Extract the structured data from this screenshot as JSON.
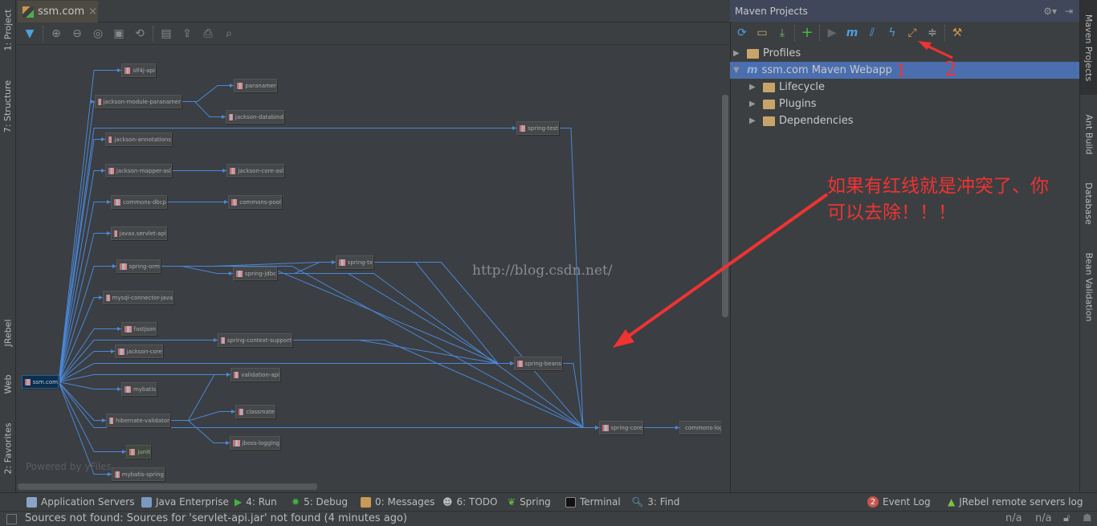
{
  "left_strip": {
    "project": "1: Project",
    "structure": "7: Structure",
    "jrebel": "JRebel",
    "web": "Web",
    "favorites": "2: Favorites"
  },
  "editor": {
    "tab_label": "ssm.com",
    "tab_close": "×",
    "watermark": "Powered by yFiles",
    "blog_watermark": "http://blog.csdn.net/"
  },
  "graph": {
    "nodes": [
      "ssm.com",
      "slf4j-api",
      "jackson-module-paranamer",
      "paranamer",
      "jackson-databind",
      "spring-test",
      "jackson-annotations",
      "jackson-mapper-asl",
      "jackson-core-asl",
      "commons-dbcp",
      "commons-pool",
      "javax.servlet-api",
      "spring-orm",
      "spring-jdbc",
      "spring-tx",
      "mysql-connector-java",
      "fastjson",
      "spring-context-support",
      "jackson-core",
      "spring-beans",
      "validation-api",
      "mybatis",
      "hibernate-validator",
      "classmate",
      "jboss-logging",
      "junit",
      "mybatis-spring",
      "spring-core",
      "commons-logging"
    ],
    "edges": [
      [
        "ssm.com",
        "slf4j-api"
      ],
      [
        "ssm.com",
        "jackson-module-paranamer"
      ],
      [
        "ssm.com",
        "spring-test"
      ],
      [
        "ssm.com",
        "jackson-annotations"
      ],
      [
        "ssm.com",
        "jackson-mapper-asl"
      ],
      [
        "ssm.com",
        "commons-dbcp"
      ],
      [
        "ssm.com",
        "javax.servlet-api"
      ],
      [
        "ssm.com",
        "spring-orm"
      ],
      [
        "ssm.com",
        "mysql-connector-java"
      ],
      [
        "ssm.com",
        "fastjson"
      ],
      [
        "ssm.com",
        "spring-context-support"
      ],
      [
        "ssm.com",
        "jackson-core"
      ],
      [
        "ssm.com",
        "spring-beans"
      ],
      [
        "ssm.com",
        "validation-api"
      ],
      [
        "ssm.com",
        "mybatis"
      ],
      [
        "ssm.com",
        "hibernate-validator"
      ],
      [
        "ssm.com",
        "junit"
      ],
      [
        "ssm.com",
        "mybatis-spring"
      ],
      [
        "ssm.com",
        "spring-core"
      ],
      [
        "jackson-module-paranamer",
        "paranamer"
      ],
      [
        "jackson-module-paranamer",
        "jackson-databind"
      ],
      [
        "jackson-mapper-asl",
        "jackson-core-asl"
      ],
      [
        "commons-dbcp",
        "commons-pool"
      ],
      [
        "spring-orm",
        "spring-jdbc"
      ],
      [
        "spring-orm",
        "spring-tx"
      ],
      [
        "spring-orm",
        "spring-beans"
      ],
      [
        "spring-orm",
        "spring-core"
      ],
      [
        "spring-jdbc",
        "spring-tx"
      ],
      [
        "spring-jdbc",
        "spring-beans"
      ],
      [
        "spring-jdbc",
        "spring-core"
      ],
      [
        "spring-tx",
        "spring-beans"
      ],
      [
        "spring-tx",
        "spring-core"
      ],
      [
        "spring-context-support",
        "spring-beans"
      ],
      [
        "spring-context-support",
        "spring-core"
      ],
      [
        "spring-beans",
        "spring-core"
      ],
      [
        "spring-test",
        "spring-core"
      ],
      [
        "hibernate-validator",
        "validation-api"
      ],
      [
        "hibernate-validator",
        "classmate"
      ],
      [
        "hibernate-validator",
        "jboss-logging"
      ],
      [
        "spring-core",
        "commons-logging"
      ]
    ],
    "selected": "ssm.com"
  },
  "maven": {
    "title": "Maven Projects",
    "tree": [
      {
        "label": "Profiles",
        "expanded": false
      },
      {
        "label": "ssm.com Maven Webapp",
        "expanded": true,
        "selected": true
      },
      {
        "label": "Lifecycle",
        "expanded": false
      },
      {
        "label": "Plugins",
        "expanded": false
      },
      {
        "label": "Dependencies",
        "expanded": false
      }
    ]
  },
  "annotation": {
    "mark1": "1",
    "mark2": "2",
    "line1": "如果有红线就是冲突了、你",
    "line2": "可以去除！！！"
  },
  "right_strip": {
    "maven": "Maven Projects",
    "ant": "Ant Build",
    "database": "Database",
    "bean": "Bean Validation"
  },
  "bottom_tools": {
    "app_servers": "Application Servers",
    "java_ee": "Java Enterprise",
    "run": "4: Run",
    "debug": "5: Debug",
    "messages": "0: Messages",
    "todo": "6: TODO",
    "spring": "Spring",
    "terminal": "Terminal",
    "find": "3: Find",
    "event_log": "Event Log",
    "event_count": "2",
    "jrebel_log": "JRebel remote servers log"
  },
  "status": {
    "message": "Sources not found: Sources for 'servlet-api.jar' not found (4 minutes ago)",
    "pos1": "n/a",
    "pos2": "n/a"
  },
  "colors": {
    "edge": "#4a88d9",
    "annotation": "#ee3333",
    "selection": "#4b6eaf"
  }
}
